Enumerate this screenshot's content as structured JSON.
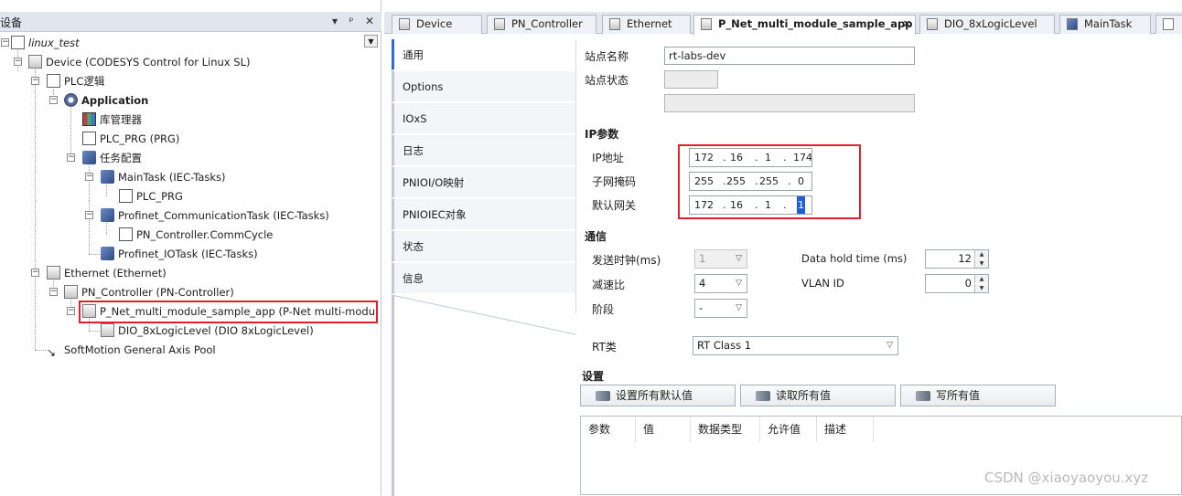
{
  "device_panel": {
    "title": "设备",
    "header_buttons": {
      "dropdown": "▾",
      "pin": "ᵖ",
      "close": "✕"
    },
    "tree": {
      "root": "linux_test",
      "device": "Device (CODESYS Control for Linux SL)",
      "plc_logic": "PLC逻辑",
      "application": "Application",
      "library_manager": "库管理器",
      "plc_prg": "PLC_PRG (PRG)",
      "task_config": "任务配置",
      "main_task": "MainTask (IEC-Tasks)",
      "main_task_pou": "PLC_PRG",
      "comm_task": "Profinet_CommunicationTask (IEC-Tasks)",
      "comm_task_pou": "PN_Controller.CommCycle",
      "io_task": "Profinet_IOTask (IEC-Tasks)",
      "ethernet": "Ethernet (Ethernet)",
      "pn_controller": "PN_Controller (PN-Controller)",
      "pnet_app": "P_Net_multi_module_sample_app (P-Net multi-module sample ap",
      "dio": "DIO_8xLogicLevel (DIO 8xLogicLevel)",
      "axis_pool": "SoftMotion General Axis Pool"
    }
  },
  "editor_tabs": [
    {
      "label": "Device"
    },
    {
      "label": "PN_Controller"
    },
    {
      "label": "Ethernet"
    },
    {
      "label": "P_Net_multi_module_sample_app",
      "close": "✕"
    },
    {
      "label": "DIO_8xLogicLevel"
    },
    {
      "label": "MainTask"
    }
  ],
  "side_tabs": [
    "通用",
    "Options",
    "IOxS",
    "日志",
    "PNIOI/O映射",
    "PNIOIEC对象",
    "状态",
    "信息"
  ],
  "general": {
    "station_name_label": "站点名称",
    "station_name_value": "rt-labs-dev",
    "station_status_label": "站点状态",
    "ip_section": "IP参数",
    "ip_address_label": "IP地址",
    "ip_address": [
      "172",
      "16",
      "1",
      "174"
    ],
    "subnet_label": "子网掩码",
    "subnet": [
      "255",
      "255",
      "255",
      "0"
    ],
    "gateway_label": "默认网关",
    "gateway": [
      "172",
      "16",
      "1",
      "1"
    ],
    "ip_separator": ".",
    "comm_section": "通信",
    "send_clock_label": "发送时钟(ms)",
    "send_clock_value": "1",
    "reduction_label": "减速比",
    "reduction_value": "4",
    "phase_label": "阶段",
    "phase_value": "-",
    "data_hold_label": "Data hold time (ms)",
    "data_hold_value": "12",
    "vlan_label": "VLAN ID",
    "vlan_value": "0",
    "rt_class_label": "RT类",
    "rt_class_value": "RT Class 1",
    "settings_section": "设置",
    "btn_set_defaults": "设置所有默认值",
    "btn_read_all": "读取所有值",
    "btn_write_all": "写所有值",
    "grid_columns": [
      "参数",
      "值",
      "数据类型",
      "允许值",
      "描述"
    ]
  },
  "watermark": "CSDN @xiaoyaoyou.xyz"
}
